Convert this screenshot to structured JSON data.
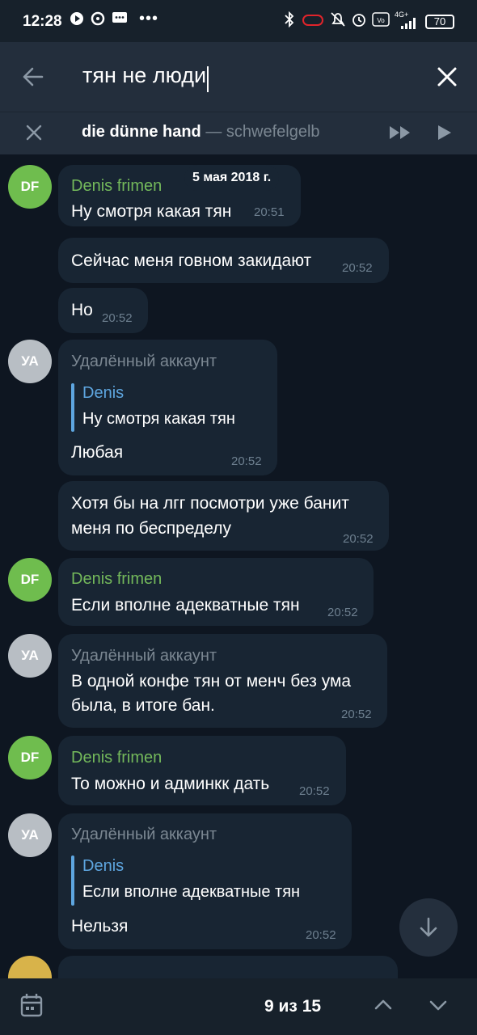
{
  "status_bar": {
    "time": "12:28",
    "battery": "70",
    "network": "4G+"
  },
  "search": {
    "query": "тян не люди",
    "back_icon": "arrow-left-icon",
    "clear_icon": "close-icon"
  },
  "player": {
    "track_title": "die dünne hand",
    "track_separator": " — ",
    "track_artist": "schwefelgelb"
  },
  "date_badge": "5 мая 2018 г.",
  "messages": [
    {
      "sender": "Denis frimen",
      "avatar": "DF",
      "text": "Ну смотря какая тян",
      "time": "20:51"
    },
    {
      "text": "Сейчас меня говном закидают",
      "time": "20:52"
    },
    {
      "text": "Но",
      "time": "20:52"
    },
    {
      "sender": "Удалённый аккаунт",
      "avatar": "УА",
      "reply_name": "Denis",
      "reply_text": "Ну смотря какая тян",
      "text": "Любая",
      "time": "20:52"
    },
    {
      "text_line1": "Хотя бы на лгг посмотри уже банит",
      "text_line2": "меня по беспределу",
      "time": "20:52"
    },
    {
      "sender": "Denis frimen",
      "avatar": "DF",
      "text": "Если вполне адекватные тян",
      "time": "20:52"
    },
    {
      "sender": "Удалённый аккаунт",
      "avatar": "УА",
      "text_line1": "В одной конфе тян от менч без ума",
      "text_line2": "была, в итоге бан.",
      "time": "20:52"
    },
    {
      "sender": "Denis frimen",
      "avatar": "DF",
      "text": "То можно и админкк дать",
      "time": "20:52"
    },
    {
      "sender": "Удалённый аккаунт",
      "avatar": "УА",
      "reply_name": "Denis",
      "reply_text": "Если вполне адекватные тян",
      "text": "Нельзя",
      "time": "20:52"
    }
  ],
  "search_nav": {
    "counter": "9 из 15"
  },
  "colors": {
    "background": "#0e1621",
    "bubble": "#182533",
    "header": "#232e3c",
    "accent_green": "#74b95b",
    "accent_blue": "#5ea6e0"
  }
}
